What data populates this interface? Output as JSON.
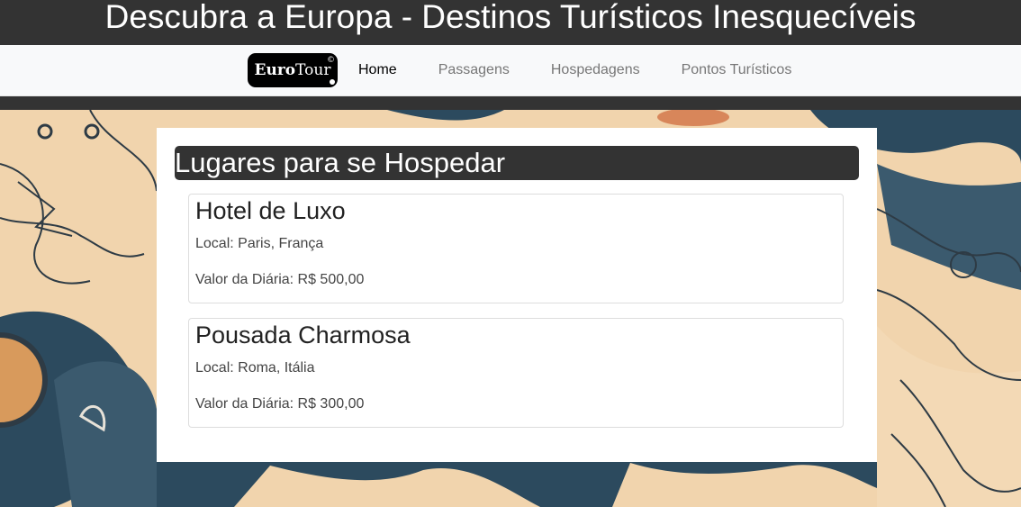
{
  "header": {
    "title": "Descubra a Europa - Destinos Turísticos Inesquecíveis"
  },
  "navbar": {
    "logo": {
      "text_main": "Euro",
      "text_accent": "Tour",
      "mark": "©"
    },
    "links": [
      {
        "label": "Home",
        "active": true
      },
      {
        "label": "Passagens",
        "active": false
      },
      {
        "label": "Hospedagens",
        "active": false
      },
      {
        "label": "Pontos Turísticos",
        "active": false
      }
    ]
  },
  "main": {
    "section_title": "Lugares para se Hospedar",
    "cards": [
      {
        "name": "Hotel de Luxo",
        "location": "Local: Paris, França",
        "price": "Valor da Diária: R$ 500,00"
      },
      {
        "name": "Pousada Charmosa",
        "location": "Local: Roma, Itália",
        "price": "Valor da Diária: R$ 300,00"
      }
    ]
  },
  "colors": {
    "dark": "#333333",
    "navbar_bg": "#f8f9fa",
    "map_land": "#f1d4ad",
    "map_sea": "#2c4a5e"
  }
}
